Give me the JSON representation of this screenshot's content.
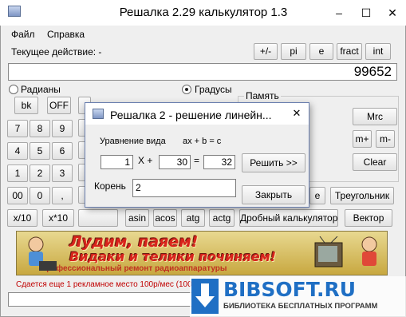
{
  "window": {
    "title": "Решалка 2.29 калькулятор 1.3",
    "minimize": "–",
    "maximize": "☐",
    "close": "✕"
  },
  "menu": [
    "Файл",
    "Справка"
  ],
  "current_action": "Текущее действие: -",
  "top_buttons": [
    "+/-",
    "pi",
    "e",
    "fract",
    "int"
  ],
  "display_value": "99652",
  "angle": {
    "radians": "Радианы",
    "degrees": "Градусы",
    "selected": "degrees"
  },
  "memory": {
    "caption": "Память",
    "mrc": "Mrc",
    "mplus": "m+",
    "mminus": "m-",
    "clear": "Clear"
  },
  "keypad": {
    "bk": "bk",
    "off": "OFF",
    "rows": [
      [
        "7",
        "8",
        "9"
      ],
      [
        "4",
        "5",
        "6"
      ],
      [
        "1",
        "2",
        "3"
      ],
      [
        "00",
        "0",
        ","
      ]
    ],
    "x10": "x/10",
    "x_times10": "x*10"
  },
  "funcs": [
    "asin",
    "acos",
    "atg",
    "actg"
  ],
  "fraction_calc": "Дробный калькулятор",
  "vector": "Вектор",
  "triangle": "Треугольник",
  "e_btn": "e",
  "banner": {
    "line1": "Лудим, паяем!",
    "line2": "Видаки и телики починяем!",
    "line3": "Профессиональный ремонт радиоаппаратуры"
  },
  "ad_text": "Сдается еще 1 рекламное место 100р/мес (1000р",
  "dialog": {
    "title": "Решалка 2 - решение линейн...",
    "close": "✕",
    "equation_label": "Уравнение вида",
    "equation_form": "ax + b = c",
    "a": "1",
    "x_plus": "X +",
    "b": "30",
    "equals": "=",
    "c": "32",
    "solve": "Решить >>",
    "root_label": "Корень",
    "root_value": "2",
    "close_btn": "Закрыть"
  },
  "watermark": {
    "title": "BIBSOFT.RU",
    "subtitle": "БИБЛИОТЕКА БЕСПЛАТНЫХ ПРОГРАММ"
  },
  "colors": {
    "ad_text": "#c00000",
    "watermark": "#1f6fc4"
  }
}
